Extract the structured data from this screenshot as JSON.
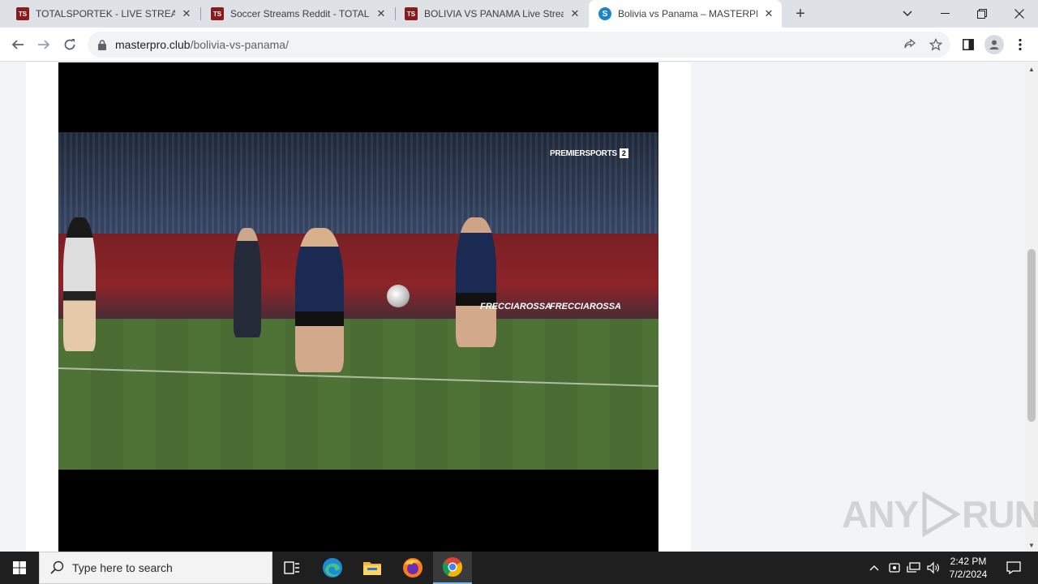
{
  "tabs": [
    {
      "favicon": "TS",
      "title": "TOTALSPORTEK - LIVE STREAMS",
      "close": "✕"
    },
    {
      "favicon": "TS",
      "title": "Soccer Streams Reddit - TOTALSP",
      "close": "✕"
    },
    {
      "favicon": "TS",
      "title": "BOLIVIA VS PANAMA Live Stream",
      "close": "✕"
    },
    {
      "favicon": "S",
      "title": "Bolivia vs Panama – MASTERPRO",
      "close": "✕"
    }
  ],
  "address": {
    "domain": "masterpro.club",
    "path": "/bolivia-vs-panama/"
  },
  "video": {
    "broadcaster": "PREMIERSPORTS",
    "channel_number": "2",
    "board_text_1": "FRECCIAROSSA",
    "board_text_2": "FRECCIAROSSA"
  },
  "watermark": {
    "left": "ANY",
    "right": "RUN"
  },
  "taskbar": {
    "search_placeholder": "Type here to search",
    "time": "2:42 PM",
    "date": "7/2/2024"
  },
  "colors": {
    "tab_strip": "#dee1e6",
    "taskbar": "#1f1f1f",
    "favicon_ts": "#8b1a1a",
    "favicon_s": "#1a86c8"
  }
}
